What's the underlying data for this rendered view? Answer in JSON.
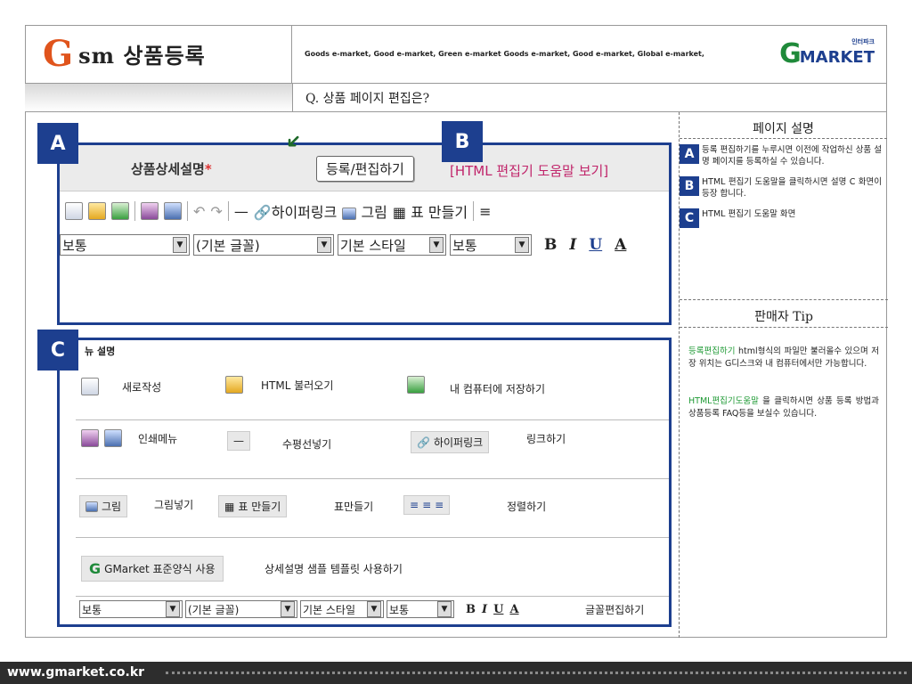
{
  "header": {
    "brand_g": "G",
    "brand_title": "sm 상품등록",
    "tagline": "Goods e-market, Good e-market, Green e-market Goods e-market, Good e-market, Global e-market,",
    "logo_g": "G",
    "logo_market": "MARKET",
    "logo_sub": "인터파크",
    "question": "Q. 상품 페이지 편집은?"
  },
  "badges": {
    "a": "A",
    "b": "B",
    "c": "C"
  },
  "editor": {
    "label": "상품상세설명",
    "required_mark": "*",
    "register_button": "등록/편집하기",
    "help_link": "[HTML 편집기 도움말 보기]",
    "toolbar": {
      "hyperlink": "하이퍼링크",
      "image": "그림",
      "table": "표 만들기"
    },
    "selects": {
      "paragraph": "보통",
      "font": "(기본 글꼴)",
      "style": "기본 스타일",
      "size": "보통"
    },
    "format": {
      "bold": "B",
      "italic": "I",
      "underline": "U",
      "color": "A"
    }
  },
  "menu": {
    "heading": "뉴 설명",
    "rows": [
      {
        "items": [
          "새로작성",
          "HTML 불러오기",
          "내 컴퓨터에 저장하기"
        ]
      },
      {
        "items": [
          "인쇄메뉴",
          "수평선넣기",
          "하이퍼링크",
          "링크하기"
        ]
      },
      {
        "items": [
          "그림",
          "그림넣기",
          "표 만들기",
          "표만들기",
          "정렬하기"
        ]
      },
      {
        "items": [
          "GMarket 표준양식 사용",
          "상세설명 샘플 템플릿 사용하기"
        ]
      },
      {
        "items": [
          "보통",
          "(기본 글꼴)",
          "기본 스타일",
          "보통",
          "글꼴편집하기"
        ]
      }
    ]
  },
  "side": {
    "title": "페이지 설명",
    "items": [
      {
        "badge": "A",
        "text": "등록 편집하기를 누루시면 이전에 작업하신 상품 설명 페이지를 등록하실 수 있습니다."
      },
      {
        "badge": "B",
        "text": "HTML 편집기 도움말을 클릭하시면 설명 C 화면이 등장 합니다."
      },
      {
        "badge": "C",
        "text": "HTML 편집기 도움말 화면"
      }
    ],
    "tip_title": "판매자 Tip",
    "tip1_hl": "등록편집하기",
    "tip1_text": " html형식의 파일만 불러올수 있으며 저장 위치는 G디스크와 내 컴퓨터에서만 가능합니다.",
    "tip2_hl": "HTML편집기도움말",
    "tip2_text": " 을 클릭하시면 상품 등록 방법과 상품등록 FAQ등을 보실수 있습니다."
  },
  "footer": {
    "url": "www.gmarket.co.kr"
  },
  "colors": {
    "accent": "#1d3f8f",
    "brand_orange": "#e0541c",
    "green": "#1f8a3a",
    "help_pink": "#c0246a"
  }
}
